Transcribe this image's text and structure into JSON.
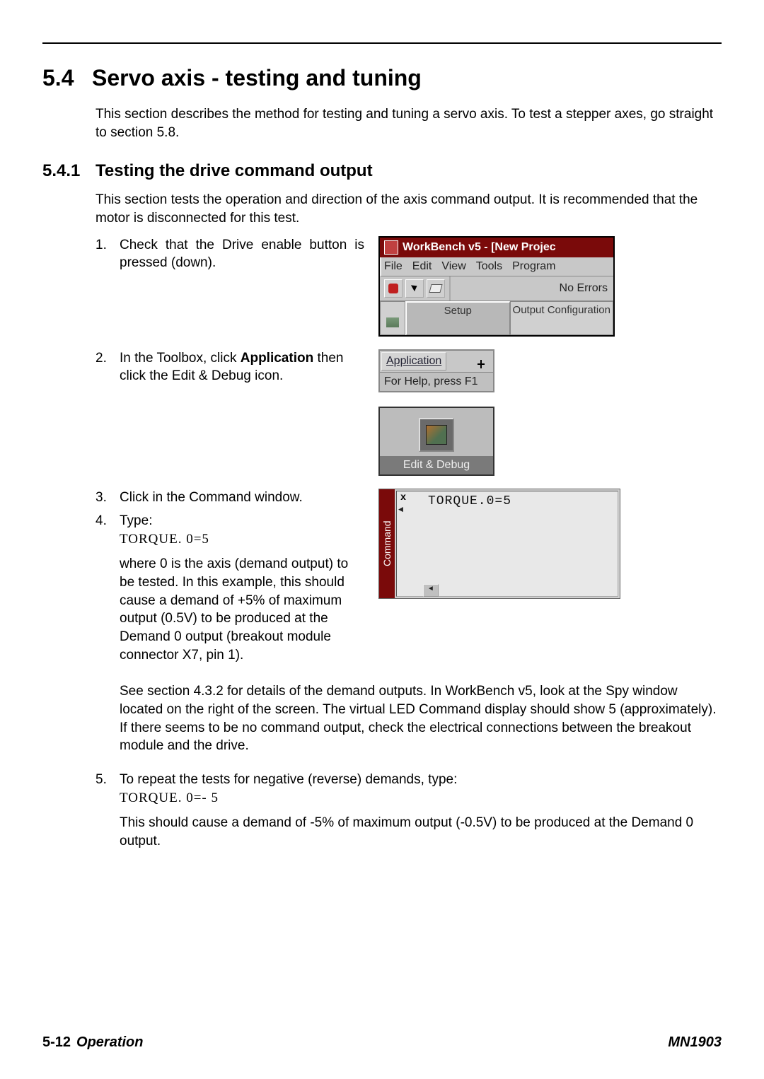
{
  "heading": {
    "number": "5.4",
    "title": "Servo axis - testing and tuning"
  },
  "intro": "This section describes the method for testing and tuning a servo axis. To test a stepper axes, go straight to section 5.8.",
  "subsection": {
    "number": "5.4.1",
    "title": "Testing the drive command output",
    "intro": "This section tests the operation and direction of the axis command output. It is recommended that the motor is disconnected for this test."
  },
  "steps": {
    "s1": "Check that the Drive enable button is pressed (down).",
    "s2a": "In the Toolbox, click ",
    "s2b": "Application",
    "s2c": " then click the Edit & Debug icon.",
    "s3": "Click in the Command window.",
    "s4a": "Type:",
    "s4b": "TORQUE. 0=5",
    "s4c": "where 0 is the axis (demand output) to be tested. In this example, this should cause a demand of +5% of maximum output (0.5V) to be produced at the Demand 0 output (breakout module connector X7, pin 1).",
    "s4d": "See section 4.3.2 for details of the demand outputs.  In WorkBench v5, look at the Spy window located on the right of the screen. The virtual LED Command display should show 5 (approximately). If there seems to be no command output, check the electrical connections between the breakout module and the drive.",
    "s5a": "To repeat the tests for negative (reverse) demands, type:",
    "s5b": "TORQUE. 0=- 5",
    "s5c": "This should cause a demand of -5% of maximum output (-0.5V) to be produced at the Demand 0 output."
  },
  "fig1": {
    "title": "WorkBench v5 - [New Projec",
    "menu": {
      "file": "File",
      "edit": "Edit",
      "view": "View",
      "tools": "Tools",
      "program": "Program"
    },
    "noerrors": "No Errors",
    "tab_setup": "Setup",
    "tab_output": "Output Configuration"
  },
  "fig2": {
    "application": "Application",
    "help": "For Help, press F1"
  },
  "fig3": {
    "label": "Edit & Debug"
  },
  "fig4": {
    "side": "Command",
    "text": "TORQUE.0=5",
    "close": "x"
  },
  "footer": {
    "left_num": "5-12",
    "left_label": "Operation",
    "right": "MN1903"
  }
}
